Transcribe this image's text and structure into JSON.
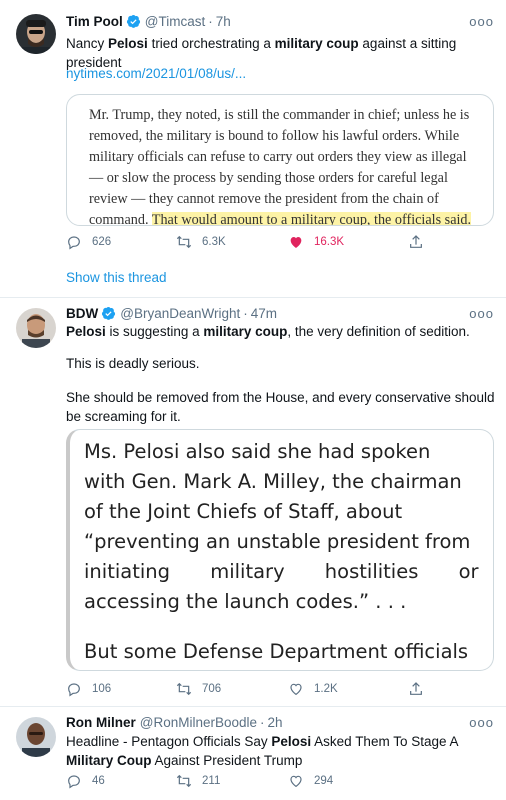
{
  "tweets": [
    {
      "name": "Tim Pool",
      "handle": "@Timcast",
      "sep": "·",
      "time": "7h",
      "more": "ooo",
      "text_parts": [
        "Nancy ",
        "Pelosi",
        " tried orchestrating a ",
        "military coup",
        " against a sitting president"
      ],
      "link": "nytimes.com/2021/01/08/us/...",
      "quote_normal": "Mr. Trump, they noted, is still the commander in chief; unless he is removed, the military is bound to follow his lawful orders. While military officials can refuse to carry out orders they view as illegal — or slow the process by sending those orders for careful legal review — they cannot remove the president from the chain of command. ",
      "quote_highlight": "That would amount to a military coup, the officials said.",
      "replies": "626",
      "retweets": "6.3K",
      "likes": "16.3K",
      "show_thread": "Show this thread"
    },
    {
      "name": "BDW",
      "handle": "@BryanDeanWright",
      "sep": "·",
      "time": "47m",
      "more": "ooo",
      "text_parts": [
        "Pelosi",
        " is suggesting a ",
        "military coup",
        ", the very definition of sedition."
      ],
      "para2": "This is deadly serious.",
      "para3": "She should be removed from the House, and every conservative should be screaming for it.",
      "quote_lines": [
        "Ms. Pelosi also said she had spoken",
        "with Gen. Mark A. Milley, the chairman",
        "of the Joint Chiefs of Staff, about",
        "“preventing an unstable president from",
        "initiating military hostilities or",
        "accessing the launch codes.” . . .",
        "But some Defense Department officials"
      ],
      "replies": "106",
      "retweets": "706",
      "likes": "1.2K"
    },
    {
      "name": "Ron Milner",
      "handle": "@RonMilnerBoodle",
      "sep": "·",
      "time": "2h",
      "more": "ooo",
      "text_parts": [
        "Headline - Pentagon Officials Say ",
        "Pelosi",
        " Asked Them To Stage A ",
        "Military Coup",
        " Against President Trump"
      ],
      "replies": "46",
      "retweets": "211",
      "likes": "294"
    }
  ],
  "colors": {
    "accent": "#1b95e0",
    "like": "#e0245e",
    "muted": "#5b7083",
    "highlight": "#fdf3a6"
  },
  "icons": [
    "verified-badge-icon",
    "reply-icon",
    "retweet-icon",
    "heart-icon",
    "share-icon",
    "more-icon"
  ]
}
